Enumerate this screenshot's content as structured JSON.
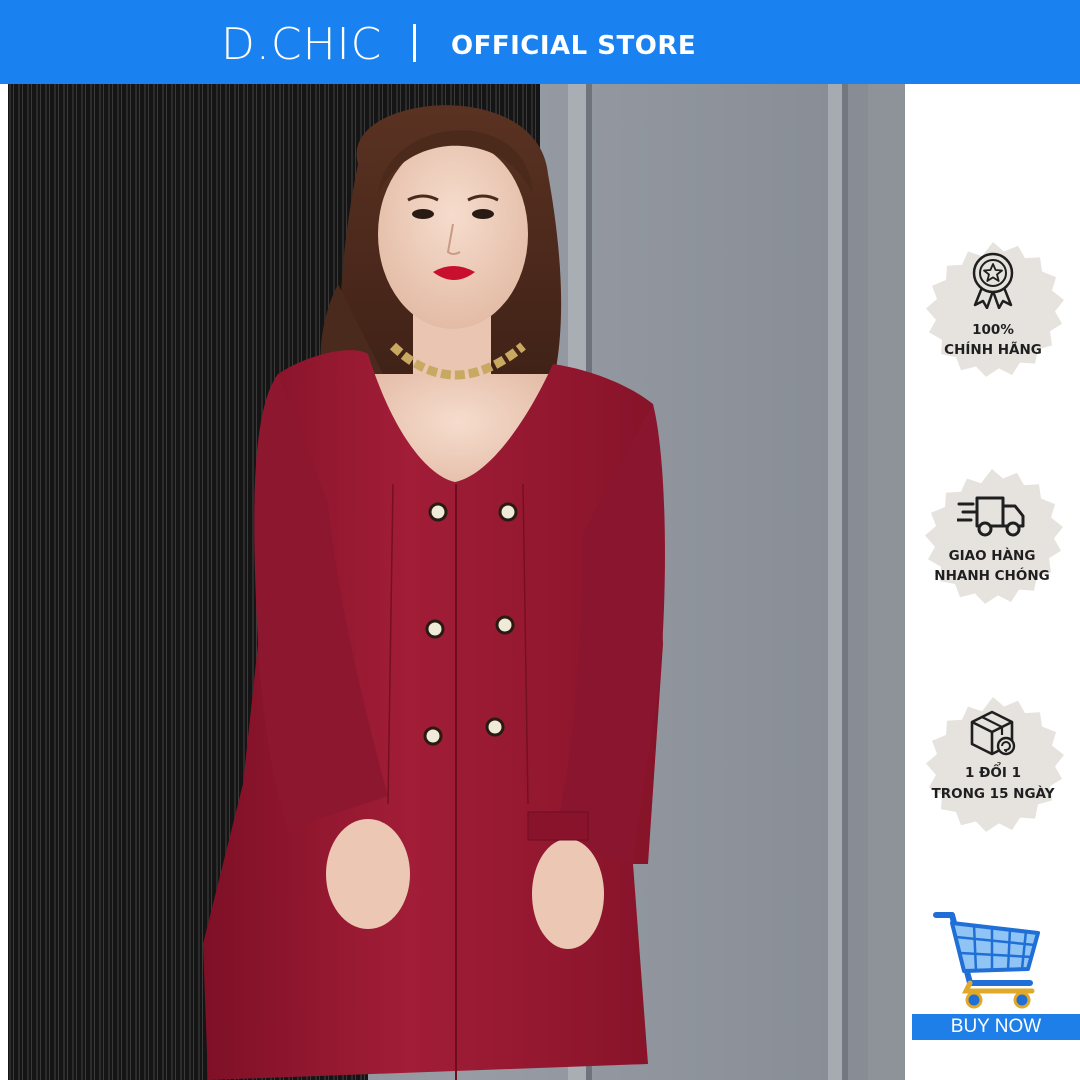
{
  "header": {
    "brand": "D.CHIC",
    "store_label": "OFFICIAL STORE",
    "background_color": "#1a82f0"
  },
  "photo": {
    "subject": "model-wearing-burgundy-double-breasted-jacket",
    "jacket_color": "#9e1b34"
  },
  "badges": [
    {
      "icon": "award-ribbon-icon",
      "line1": "100%",
      "line2": "CHÍNH HÃNG"
    },
    {
      "icon": "delivery-truck-icon",
      "line1": "GIAO HÀNG",
      "line2": "NHANH CHÓNG"
    },
    {
      "icon": "package-return-icon",
      "line1": "1 ĐỔI 1",
      "line2": "TRONG 15 NGÀY"
    }
  ],
  "badge_color": "#e6e3df",
  "cta": {
    "icon": "shopping-cart-icon",
    "label": "BUY NOW",
    "color": "#1f7fe8"
  }
}
